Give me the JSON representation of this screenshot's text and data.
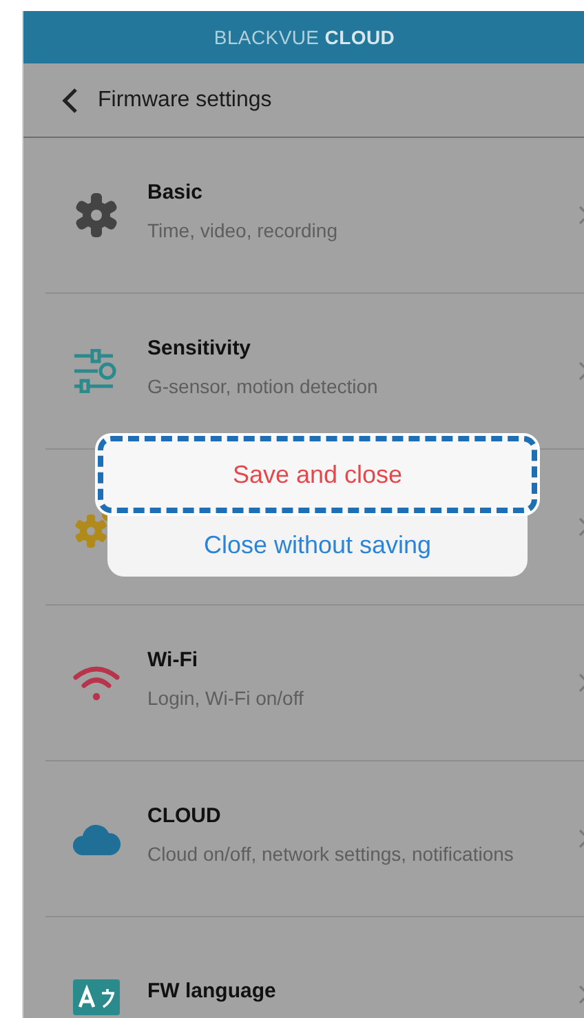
{
  "header": {
    "brand": "BLACKVUE",
    "product": "CLOUD"
  },
  "nav": {
    "title": "Firmware settings"
  },
  "items": [
    {
      "kind": "gear",
      "title": "Basic",
      "subtitle": "Time, video, recording"
    },
    {
      "kind": "sliders",
      "title": "Sensitivity",
      "subtitle": "G-sensor, motion detection"
    },
    {
      "kind": "gears"
    },
    {
      "kind": "wifi",
      "title": "Wi-Fi",
      "subtitle": "Login, Wi-Fi on/off"
    },
    {
      "kind": "cloud",
      "title": "CLOUD",
      "subtitle": "Cloud on/off, network settings, notifications"
    },
    {
      "kind": "language",
      "title": "FW language"
    }
  ],
  "dialog": {
    "actions": [
      {
        "label": "Save and close",
        "kind": "destructive",
        "highlighted": true
      },
      {
        "label": "Close without saving",
        "kind": "default",
        "highlighted": false
      }
    ]
  }
}
